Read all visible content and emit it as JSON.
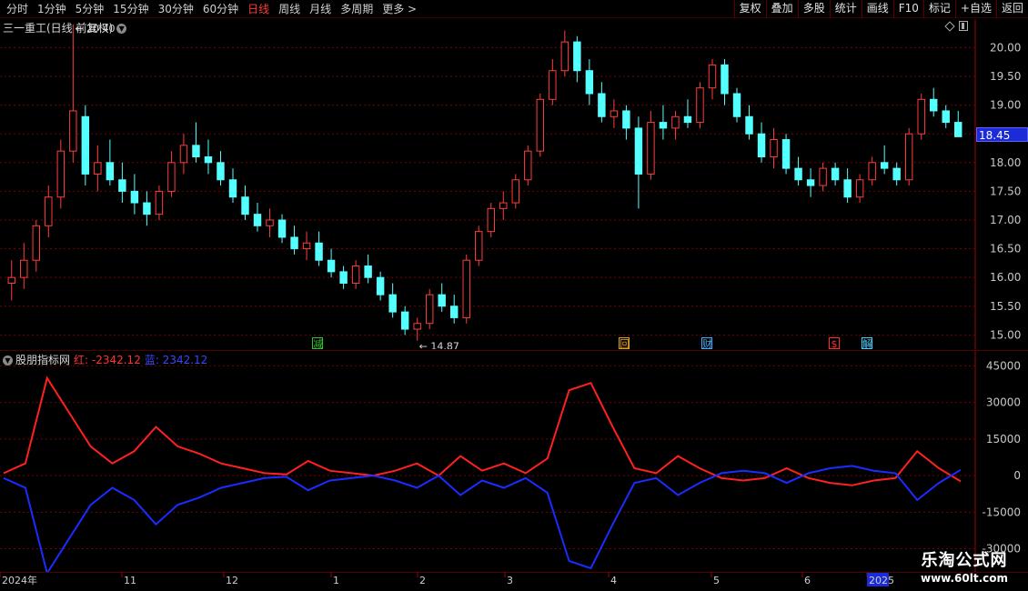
{
  "toolbar": {
    "periods": [
      "分时",
      "1分钟",
      "5分钟",
      "15分钟",
      "30分钟",
      "60分钟",
      "日线",
      "周线",
      "月线",
      "多周期",
      "更多 >"
    ],
    "active_period": "日线",
    "actions": [
      "复权",
      "叠加",
      "多股",
      "统计",
      "画线",
      "F10",
      "标记",
      "+自选",
      "返回"
    ]
  },
  "stock": {
    "title": "三一重工(日线 前复权)",
    "high_label": "20.40",
    "low_label": "14.87",
    "current_price": "18.45",
    "price_ticks": [
      "20.00",
      "19.50",
      "19.00",
      "18.50",
      "18.00",
      "17.50",
      "17.00",
      "16.50",
      "16.00",
      "15.50",
      "15.00"
    ]
  },
  "markers": [
    {
      "glyph": "减",
      "color": "#30c030"
    },
    {
      "glyph": "回",
      "color": "#e0a020"
    },
    {
      "glyph": "财",
      "color": "#40b0ff"
    },
    {
      "glyph": "$",
      "color": "#ff3030"
    },
    {
      "glyph": "解",
      "color": "#40d0ff"
    }
  ],
  "indicator": {
    "name": "股朋指标网",
    "red_label": "红: -2342.12",
    "blue_label": "蓝: 2342.12",
    "ticks": [
      "45000",
      "30000",
      "15000",
      "0",
      "-15000",
      "-30000"
    ]
  },
  "date_axis": [
    "2024年",
    "11",
    "12",
    "1",
    "2",
    "3",
    "4",
    "5",
    "6",
    "2025"
  ],
  "watermark": {
    "name": "乐淘公式网",
    "url": "www.60lt.com"
  },
  "colors": {
    "up": "#ff3c3c",
    "down": "#54ffff",
    "red_line": "#ff2020",
    "blue_line": "#1a2cff",
    "grid": "#7a0000"
  },
  "chart_data": {
    "type": "candlestick",
    "ylim": [
      14.8,
      20.45
    ],
    "candles_ohlc": [
      [
        15.9,
        16.3,
        15.6,
        16.0
      ],
      [
        16.0,
        16.6,
        15.8,
        16.3
      ],
      [
        16.3,
        17.0,
        16.1,
        16.9
      ],
      [
        16.9,
        17.6,
        16.7,
        17.4
      ],
      [
        17.4,
        18.4,
        17.2,
        18.2
      ],
      [
        18.2,
        20.4,
        18.0,
        18.9
      ],
      [
        18.8,
        19.0,
        17.6,
        17.8
      ],
      [
        17.8,
        18.3,
        17.5,
        18.0
      ],
      [
        18.0,
        18.4,
        17.6,
        17.7
      ],
      [
        17.7,
        18.0,
        17.3,
        17.5
      ],
      [
        17.5,
        17.8,
        17.1,
        17.3
      ],
      [
        17.3,
        17.5,
        16.9,
        17.1
      ],
      [
        17.1,
        17.6,
        17.0,
        17.5
      ],
      [
        17.5,
        18.2,
        17.4,
        18.0
      ],
      [
        18.0,
        18.5,
        17.8,
        18.3
      ],
      [
        18.3,
        18.7,
        18.0,
        18.1
      ],
      [
        18.1,
        18.4,
        17.8,
        18.0
      ],
      [
        18.0,
        18.2,
        17.6,
        17.7
      ],
      [
        17.7,
        17.9,
        17.3,
        17.4
      ],
      [
        17.4,
        17.6,
        17.0,
        17.1
      ],
      [
        17.1,
        17.3,
        16.8,
        16.9
      ],
      [
        16.9,
        17.2,
        16.7,
        17.0
      ],
      [
        17.0,
        17.1,
        16.6,
        16.7
      ],
      [
        16.7,
        16.9,
        16.4,
        16.5
      ],
      [
        16.5,
        16.8,
        16.3,
        16.6
      ],
      [
        16.6,
        16.8,
        16.2,
        16.3
      ],
      [
        16.3,
        16.5,
        16.0,
        16.1
      ],
      [
        16.1,
        16.2,
        15.8,
        15.9
      ],
      [
        15.9,
        16.3,
        15.8,
        16.2
      ],
      [
        16.2,
        16.4,
        15.9,
        16.0
      ],
      [
        16.0,
        16.1,
        15.6,
        15.7
      ],
      [
        15.7,
        15.9,
        15.3,
        15.4
      ],
      [
        15.4,
        15.5,
        15.0,
        15.1
      ],
      [
        15.1,
        15.3,
        14.9,
        15.2
      ],
      [
        15.2,
        15.8,
        15.1,
        15.7
      ],
      [
        15.7,
        15.9,
        15.4,
        15.5
      ],
      [
        15.5,
        15.7,
        15.2,
        15.3
      ],
      [
        15.3,
        16.4,
        15.2,
        16.3
      ],
      [
        16.3,
        16.9,
        16.2,
        16.8
      ],
      [
        16.8,
        17.3,
        16.7,
        17.2
      ],
      [
        17.2,
        17.5,
        17.0,
        17.3
      ],
      [
        17.3,
        17.8,
        17.2,
        17.7
      ],
      [
        17.7,
        18.3,
        17.6,
        18.2
      ],
      [
        18.2,
        19.2,
        18.1,
        19.1
      ],
      [
        19.1,
        19.8,
        19.0,
        19.6
      ],
      [
        19.6,
        20.3,
        19.5,
        20.1
      ],
      [
        20.1,
        20.2,
        19.4,
        19.6
      ],
      [
        19.6,
        19.8,
        19.0,
        19.2
      ],
      [
        19.2,
        19.4,
        18.7,
        18.8
      ],
      [
        18.8,
        19.1,
        18.6,
        18.9
      ],
      [
        18.9,
        19.0,
        18.4,
        18.6
      ],
      [
        18.6,
        18.8,
        17.2,
        17.8
      ],
      [
        17.8,
        18.9,
        17.7,
        18.7
      ],
      [
        18.7,
        19.0,
        18.4,
        18.6
      ],
      [
        18.6,
        18.9,
        18.4,
        18.8
      ],
      [
        18.8,
        19.1,
        18.6,
        18.7
      ],
      [
        18.7,
        19.4,
        18.6,
        19.3
      ],
      [
        19.3,
        19.8,
        19.1,
        19.7
      ],
      [
        19.7,
        19.8,
        19.0,
        19.2
      ],
      [
        19.2,
        19.3,
        18.7,
        18.8
      ],
      [
        18.8,
        19.0,
        18.4,
        18.5
      ],
      [
        18.5,
        18.7,
        18.0,
        18.1
      ],
      [
        18.1,
        18.6,
        17.9,
        18.4
      ],
      [
        18.4,
        18.5,
        17.8,
        17.9
      ],
      [
        17.9,
        18.1,
        17.6,
        17.7
      ],
      [
        17.7,
        17.9,
        17.4,
        17.6
      ],
      [
        17.6,
        18.0,
        17.5,
        17.9
      ],
      [
        17.9,
        18.0,
        17.6,
        17.7
      ],
      [
        17.7,
        17.9,
        17.3,
        17.4
      ],
      [
        17.4,
        17.8,
        17.3,
        17.7
      ],
      [
        17.7,
        18.1,
        17.6,
        18.0
      ],
      [
        18.0,
        18.3,
        17.8,
        17.9
      ],
      [
        17.9,
        18.0,
        17.6,
        17.7
      ],
      [
        17.7,
        18.6,
        17.6,
        18.5
      ],
      [
        18.5,
        19.2,
        18.4,
        19.1
      ],
      [
        19.1,
        19.3,
        18.8,
        18.9
      ],
      [
        18.9,
        19.0,
        18.6,
        18.7
      ],
      [
        18.7,
        18.9,
        18.5,
        18.45
      ]
    ],
    "indicator_red": [
      1000,
      5000,
      40000,
      26000,
      12000,
      5000,
      10000,
      20000,
      12000,
      9000,
      5000,
      3000,
      1000,
      500,
      6000,
      2000,
      1000,
      0,
      2000,
      5000,
      0,
      8000,
      2000,
      5000,
      1000,
      7000,
      35000,
      38000,
      20000,
      3000,
      1000,
      8000,
      3000,
      -1000,
      -2000,
      -1000,
      3000,
      -1000,
      -3000,
      -4000,
      -2000,
      -1000,
      10000,
      3000,
      -2342
    ],
    "indicator_blue": [
      -1000,
      -5000,
      -40000,
      -26000,
      -12000,
      -5000,
      -10000,
      -20000,
      -12000,
      -9000,
      -5000,
      -3000,
      -1000,
      -500,
      -6000,
      -2000,
      -1000,
      0,
      -2000,
      -5000,
      0,
      -8000,
      -2000,
      -5000,
      -1000,
      -7000,
      -35000,
      -38000,
      -20000,
      -3000,
      -1000,
      -8000,
      -3000,
      1000,
      2000,
      1000,
      -3000,
      1000,
      3000,
      4000,
      2000,
      1000,
      -10000,
      -3000,
      2342
    ],
    "indicator_ylim": [
      -38000,
      50000
    ]
  }
}
